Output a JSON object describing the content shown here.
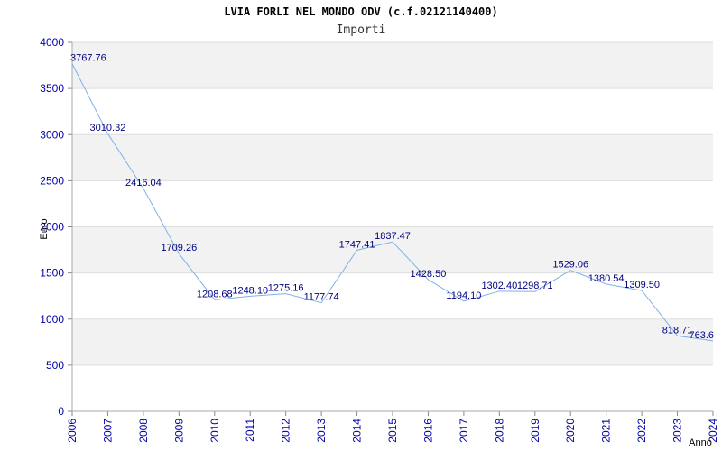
{
  "chart_data": {
    "type": "line",
    "title": "LVIA FORLI NEL MONDO ODV (c.f.02121140400)",
    "subtitle": "Importi",
    "xlabel": "Anno",
    "ylabel": "Euro",
    "ylim": [
      0,
      4000
    ],
    "yticks": [
      0,
      500,
      1000,
      1500,
      2000,
      2500,
      3000,
      3500,
      4000
    ],
    "x": [
      "2006",
      "2007",
      "2008",
      "2009",
      "2010",
      "2011",
      "2012",
      "2013",
      "2014",
      "2015",
      "2016",
      "2017",
      "2018",
      "2019",
      "2020",
      "2021",
      "2022",
      "2023",
      "2024"
    ],
    "values": [
      3767.76,
      3010.32,
      2416.04,
      1709.26,
      1208.68,
      1248.1,
      1275.16,
      1177.74,
      1747.41,
      1837.47,
      1428.5,
      1194.1,
      1302.4,
      1298.71,
      1529.06,
      1380.54,
      1309.5,
      818.71,
      763.6
    ],
    "labels": [
      "3767.76",
      "3010.32",
      "2416.04",
      "1709.26",
      "1208.68",
      "1248.10",
      "1275.16",
      "1177.74",
      "1747.41",
      "1837.47",
      "1428.50",
      "1194.10",
      "1302.40",
      "1298.71",
      "1529.06",
      "1380.54",
      "1309.50",
      "818.71",
      "763.6"
    ],
    "grid": true,
    "colors": {
      "line": "#7fb2e8",
      "band": "#f2f2f2",
      "tick": "#0000aa",
      "label": "#000080"
    }
  }
}
